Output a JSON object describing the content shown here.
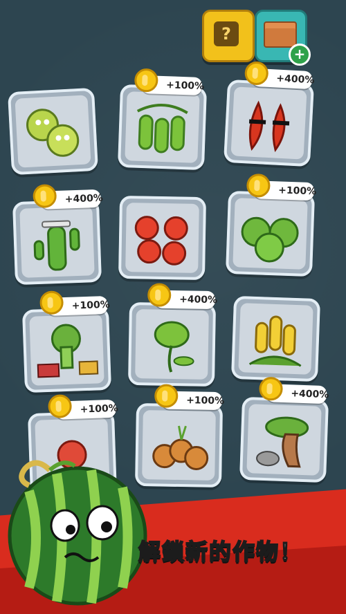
{
  "top_buttons": {
    "help_label": "?",
    "crate_plus": "+"
  },
  "cards": [
    {
      "bonus": "",
      "icon": "cabbage-icon"
    },
    {
      "bonus": "+100%",
      "icon": "pea-pod-icon"
    },
    {
      "bonus": "+400%",
      "icon": "chili-peppers-icon"
    },
    {
      "bonus": "+400%",
      "icon": "cactus-icon"
    },
    {
      "bonus": "",
      "icon": "tomatoes-icon"
    },
    {
      "bonus": "+100%",
      "icon": "melons-icon"
    },
    {
      "bonus": "+100%",
      "icon": "broccoli-icon"
    },
    {
      "bonus": "+400%",
      "icon": "flytrap-icon"
    },
    {
      "bonus": "",
      "icon": "corn-icon"
    },
    {
      "bonus": "+100%",
      "icon": "radish-icon"
    },
    {
      "bonus": "+100%",
      "icon": "onions-icon"
    },
    {
      "bonus": "+400%",
      "icon": "bonsai-icon"
    }
  ],
  "caption": "解鎖新的作物！",
  "colors": {
    "background": "#2f4650",
    "card_frame": "#a2b0bd",
    "coin": "#f7c614",
    "banner": "#d92c1e"
  }
}
